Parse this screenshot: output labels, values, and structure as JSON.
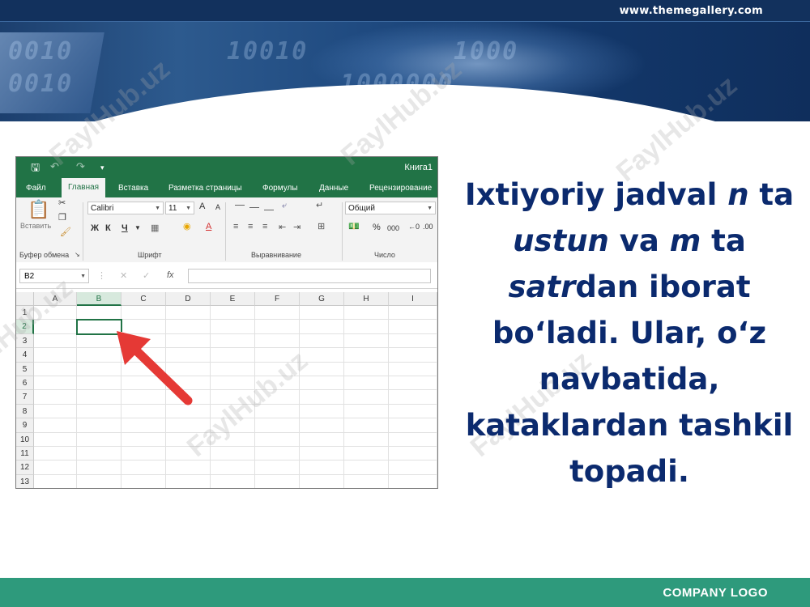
{
  "header": {
    "url": "www.themegallery.com",
    "digits": [
      "0010",
      "0010",
      "10010",
      "1000",
      "1000000"
    ]
  },
  "watermark": "FaylHub.uz",
  "excel": {
    "title": "Книга1",
    "tabs": [
      "Файл",
      "Главная",
      "Вставка",
      "Разметка страницы",
      "Формулы",
      "Данные",
      "Рецензирование"
    ],
    "active_tab": "Главная",
    "ribbon": {
      "paste_label": "Вставить",
      "clipboard_group": "Буфер обмена",
      "font_group": "Шрифт",
      "align_group": "Выравнивание",
      "number_group": "Число",
      "font_name": "Calibri",
      "font_size": "11",
      "number_format": "Общий",
      "grow_font": "A",
      "shrink_font": "A",
      "bold": "Ж",
      "italic": "К",
      "underline": "Ч",
      "percent": "%",
      "thousands": "000"
    },
    "name_box": "B2",
    "fx": "fx",
    "columns": [
      "A",
      "B",
      "C",
      "D",
      "E",
      "F",
      "G",
      "H",
      "I"
    ],
    "rows": [
      "1",
      "2",
      "3",
      "4",
      "5",
      "6",
      "7",
      "8",
      "9",
      "10",
      "11",
      "12",
      "13"
    ],
    "selected_cell": "B2",
    "accent": "#217346"
  },
  "body": {
    "line1_a": "Ixtiyoriy jadval ",
    "line1_n": "n",
    "line1_b": " ta",
    "line2_ustun": "ustun",
    "line2_va": " va ",
    "line2_m": "m",
    "line2_ta": " ta",
    "line3_satr": "satr",
    "line3_rest": "dan iborat",
    "line4": "bo‘ladi. Ular, o‘z",
    "line5": "navbatida,",
    "line6": "kataklardan tashkil",
    "line7": "topadi."
  },
  "footer": {
    "logo": "COMPANY LOGO"
  },
  "colors": {
    "title_text": "#0b2a6e",
    "footer": "#2e9a7c",
    "arrow": "#e53935",
    "excel_green": "#217346"
  }
}
